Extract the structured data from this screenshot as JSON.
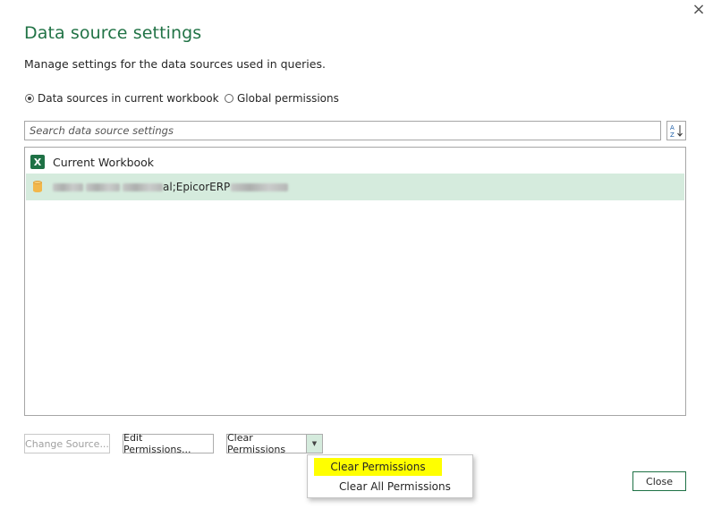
{
  "dialog": {
    "title": "Data source settings",
    "subtitle": "Manage settings for the data sources used in queries.",
    "close_icon": "×"
  },
  "scope": {
    "current_label": "Data sources in current workbook",
    "global_label": "Global permissions",
    "selected": "current"
  },
  "search": {
    "placeholder": "Search data source settings",
    "sort_icon": "sort-az-icon"
  },
  "list": {
    "group_label": "Current Workbook",
    "group_icon_glyph": "X",
    "source_visible_text": "al;EpicorERP"
  },
  "buttons": {
    "change_source": "Change Source...",
    "edit_permissions": "Edit Permissions...",
    "clear_permissions": "Clear Permissions",
    "close": "Close"
  },
  "dropdown_menu": {
    "items": [
      "Clear Permissions",
      "Clear All Permissions"
    ],
    "highlighted_index": 0
  },
  "colors": {
    "accent": "#217346",
    "selected_row": "#d5ebdd",
    "highlight": "#ffff00"
  }
}
